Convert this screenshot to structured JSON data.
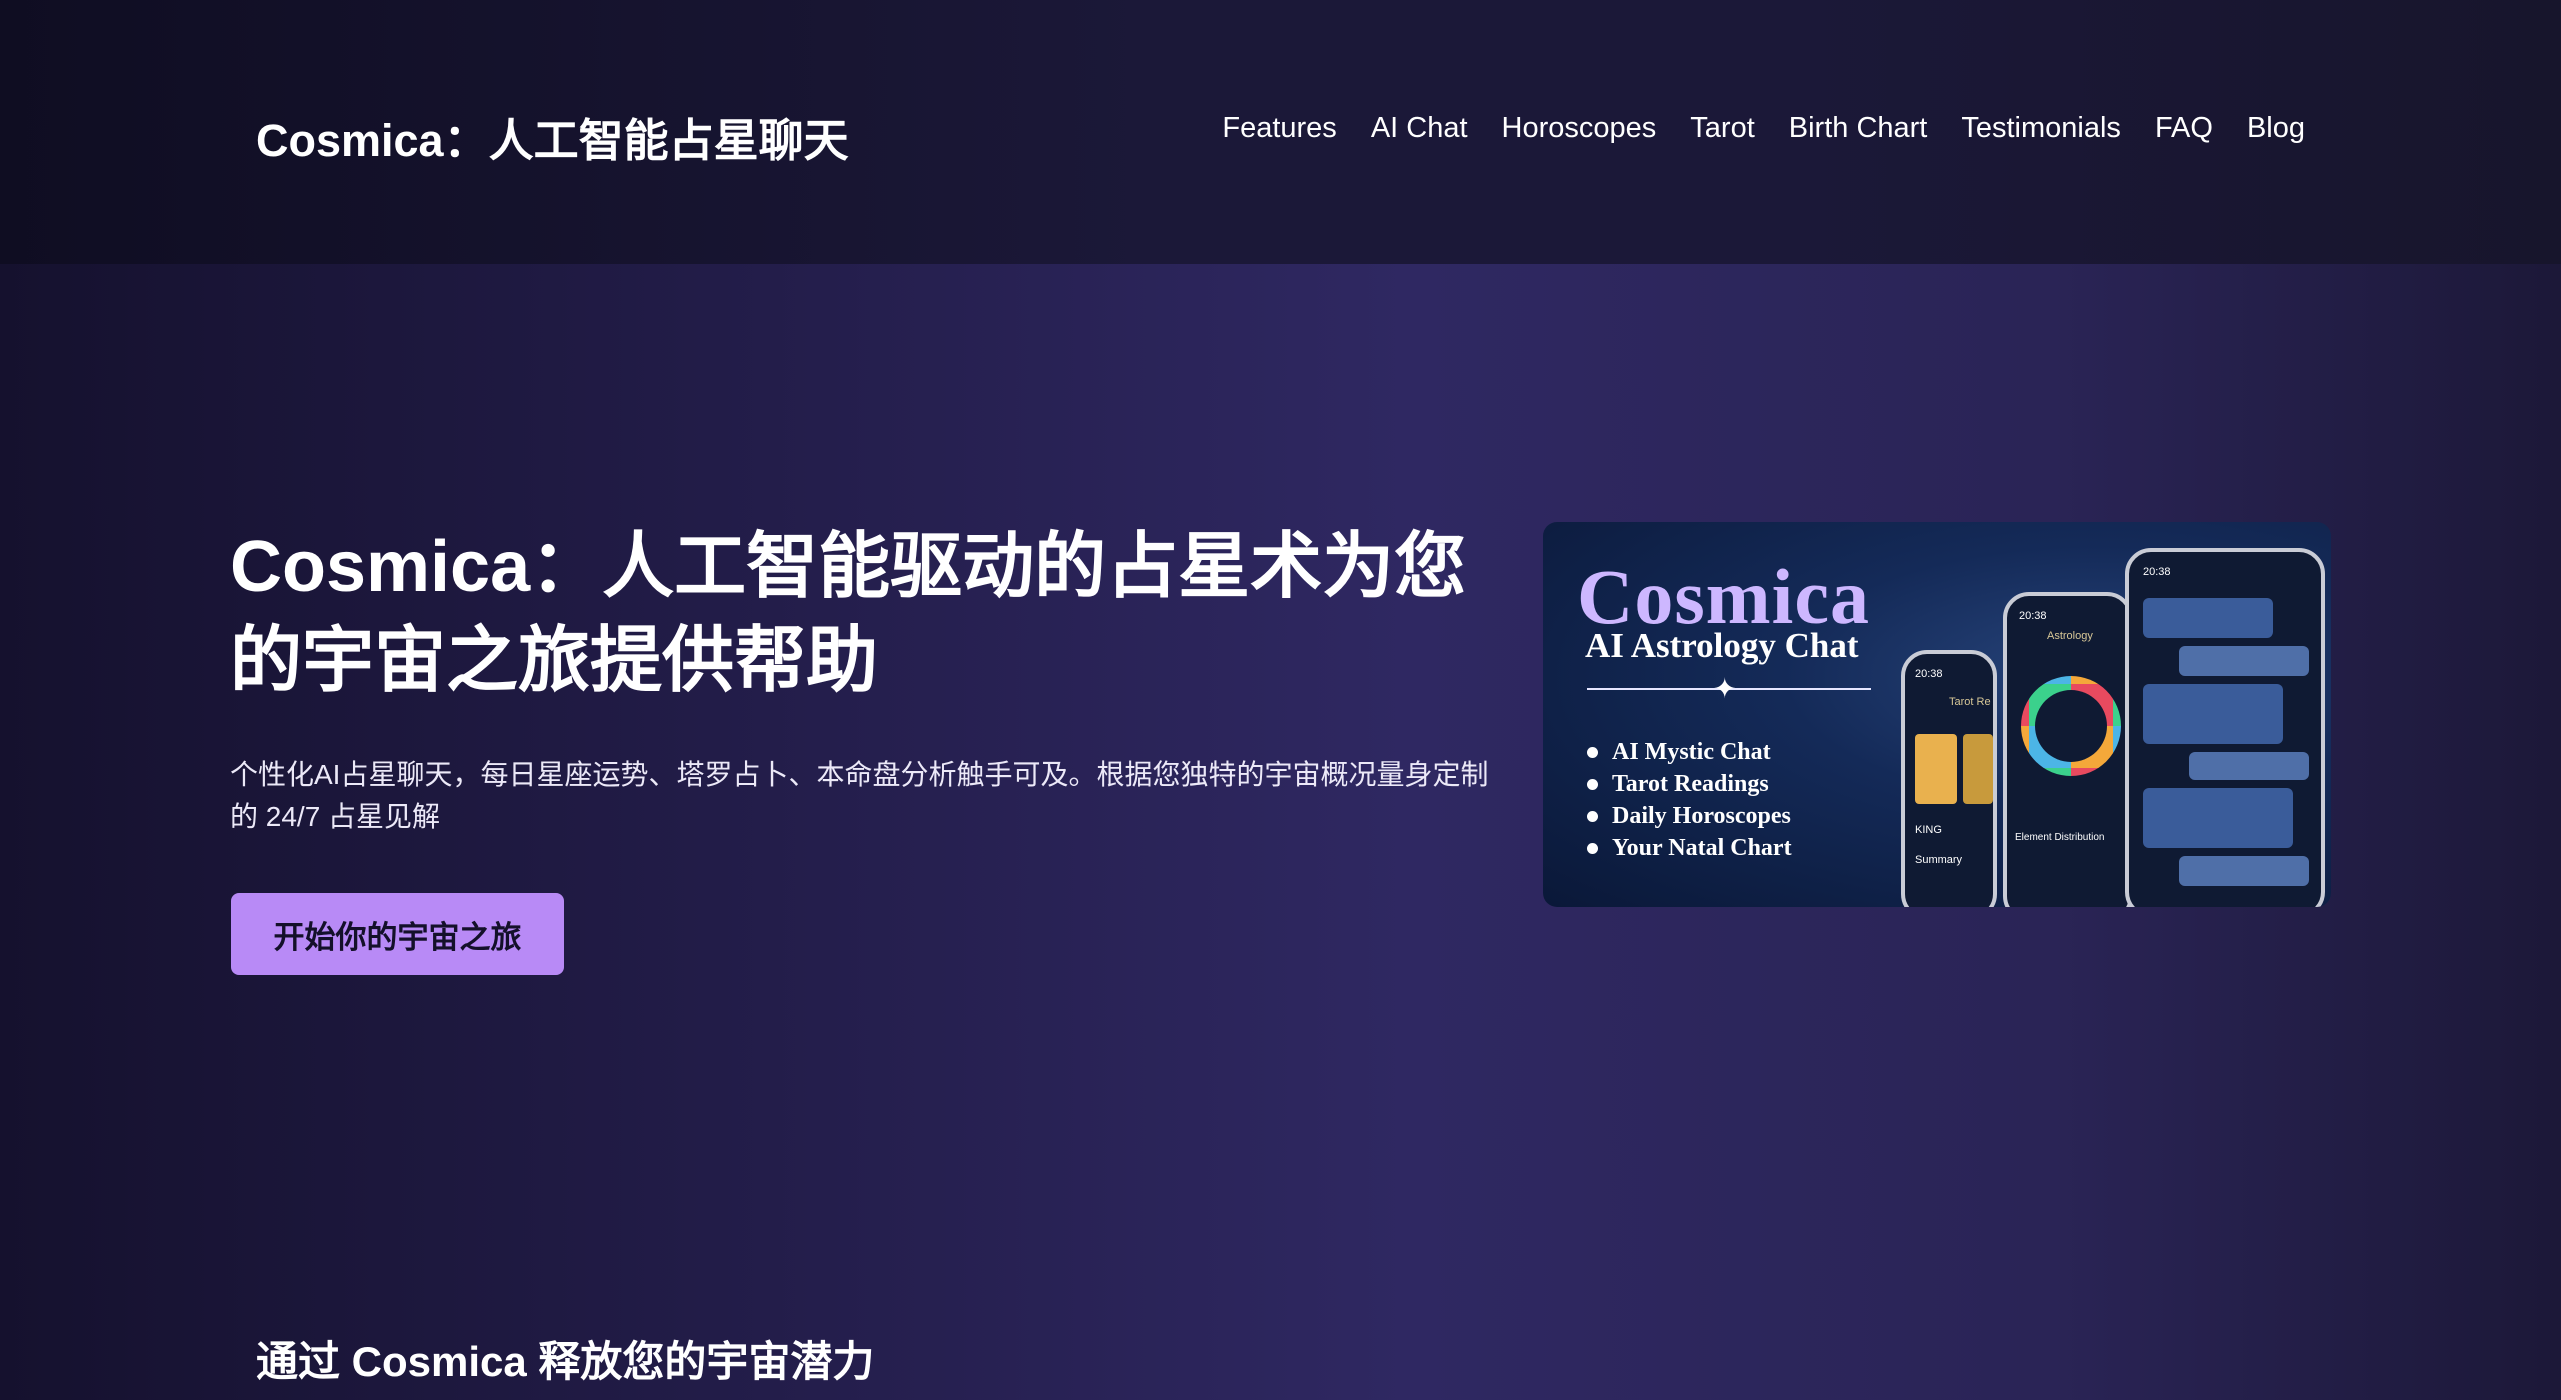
{
  "header": {
    "brand": "Cosmica：人工智能占星聊天",
    "nav": [
      "Features",
      "AI Chat",
      "Horoscopes",
      "Tarot",
      "Birth Chart",
      "Testimonials",
      "FAQ",
      "Blog"
    ]
  },
  "hero": {
    "title": "Cosmica：人工智能驱动的占星术为您的宇宙之旅提供帮助",
    "subtitle": "个性化AI占星聊天，每日星座运势、塔罗占卜、本命盘分析触手可及。根据您独特的宇宙概况量身定制的 24/7 占星见解",
    "cta": "开始你的宇宙之旅"
  },
  "promo": {
    "logo": "Cosmica",
    "subtitle": "AI Astrology Chat",
    "features": [
      "AI Mystic Chat",
      "Tarot Readings",
      "Daily Horoscopes",
      "Your Natal Chart"
    ],
    "phone_labels": {
      "tarot": "Tarot Re",
      "astrology": "Astrology",
      "king": "KING",
      "summary": "Summary",
      "element": "Element Distribution",
      "time": "20:38"
    }
  },
  "section": {
    "title": "通过 Cosmica 释放您的宇宙潜力"
  }
}
